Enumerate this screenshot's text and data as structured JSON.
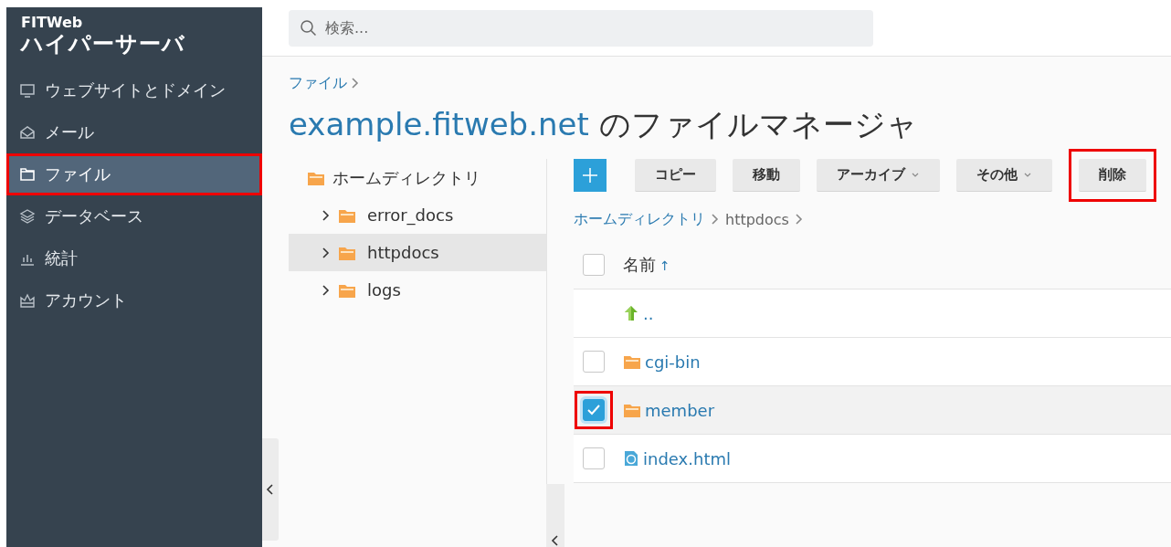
{
  "brand": {
    "line1": "FITWeb",
    "line2": "ハイパーサーバ"
  },
  "sidebar": {
    "items": [
      {
        "label": "ウェブサイトとドメイン",
        "selected": false,
        "highlighted": false
      },
      {
        "label": "メール",
        "selected": false,
        "highlighted": false
      },
      {
        "label": "ファイル",
        "selected": true,
        "highlighted": true
      },
      {
        "label": "データベース",
        "selected": false,
        "highlighted": false
      },
      {
        "label": "統計",
        "selected": false,
        "highlighted": false
      },
      {
        "label": "アカウント",
        "selected": false,
        "highlighted": false
      }
    ]
  },
  "search": {
    "placeholder": "検索..."
  },
  "breadcrumb": [
    {
      "label": "ファイル"
    }
  ],
  "title": {
    "domain": "example.fitweb.net",
    "suffix": "のファイルマネージャ"
  },
  "tree": {
    "root": "ホームディレクトリ",
    "children": [
      {
        "label": "error_docs",
        "expanded": false,
        "selected": false
      },
      {
        "label": "httpdocs",
        "expanded": false,
        "selected": true
      },
      {
        "label": "logs",
        "expanded": false,
        "selected": false
      }
    ]
  },
  "toolbar": {
    "buttons": [
      {
        "label": "コピー",
        "dropdown": false,
        "highlighted": false
      },
      {
        "label": "移動",
        "dropdown": false,
        "highlighted": false
      },
      {
        "label": "アーカイブ",
        "dropdown": true,
        "highlighted": false
      },
      {
        "label": "その他",
        "dropdown": true,
        "highlighted": false
      },
      {
        "label": "削除",
        "dropdown": false,
        "highlighted": true
      }
    ]
  },
  "path": [
    {
      "label": "ホームディレクトリ"
    },
    {
      "label": "httpdocs"
    }
  ],
  "table": {
    "header": {
      "label": "名前",
      "sort_mark": "↑",
      "checked": false
    },
    "rows": [
      {
        "kind": "parent",
        "name": ".."
      },
      {
        "kind": "folder",
        "name": "cgi-bin",
        "checked": false,
        "highlighted": false
      },
      {
        "kind": "folder",
        "name": "member",
        "checked": true,
        "highlighted": true
      },
      {
        "kind": "html",
        "name": "index.html",
        "checked": false,
        "highlighted": false
      }
    ]
  }
}
